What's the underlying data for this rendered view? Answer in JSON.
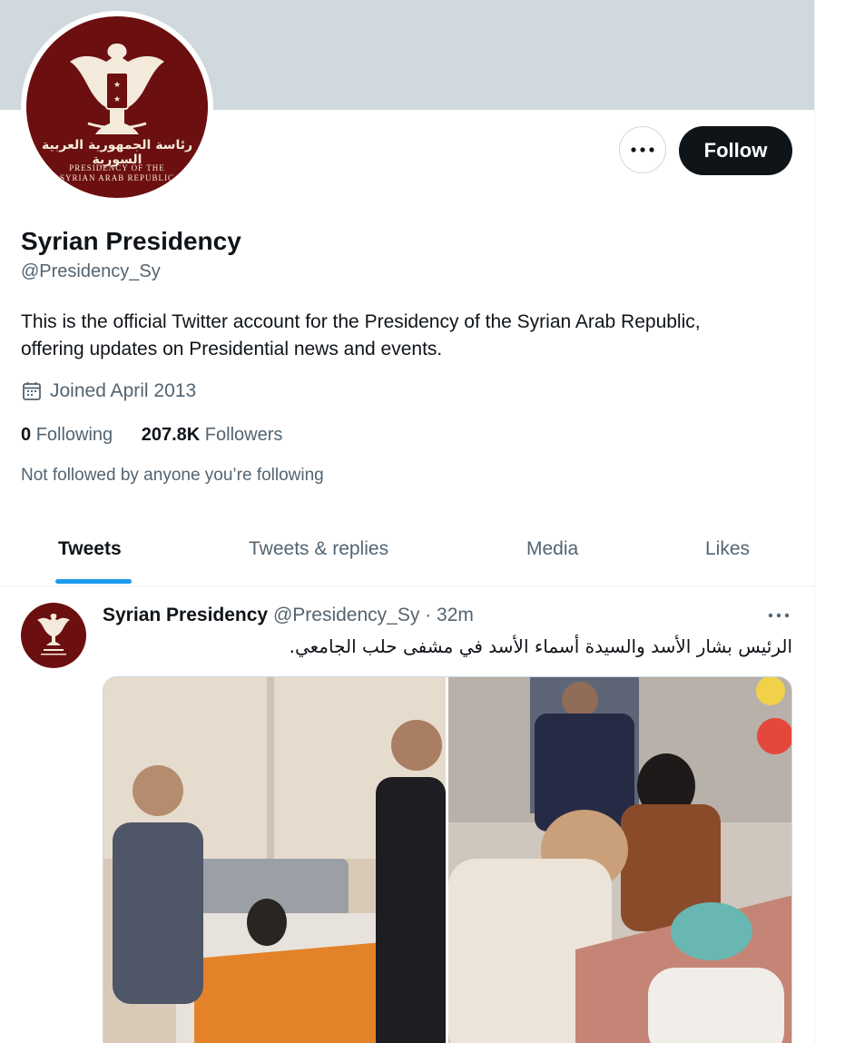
{
  "profile": {
    "avatar_arabic": "رئاسة الجمهورية العربية السورية",
    "avatar_english_line1": "PRESIDENCY OF THE",
    "avatar_english_line2": "SYRIAN ARAB REPUBLIC",
    "name": "Syrian Presidency",
    "handle": "@Presidency_Sy",
    "bio": "This is the official Twitter account for the Presidency of the Syrian Arab Republic, offering updates on Presidential news and events.",
    "joined": "Joined April 2013",
    "following_count": "0",
    "following_label": "Following",
    "followers_count": "207.8K",
    "followers_label": "Followers",
    "not_followed_text": "Not followed by anyone you’re following"
  },
  "actions": {
    "follow_label": "Follow",
    "more_icon": "more-horizontal-icon"
  },
  "tabs": [
    {
      "label": "Tweets",
      "active": true
    },
    {
      "label": "Tweets & replies",
      "active": false
    },
    {
      "label": "Media",
      "active": false
    },
    {
      "label": "Likes",
      "active": false
    }
  ],
  "tweet": {
    "name": "Syrian Presidency",
    "handle": "@Presidency_Sy",
    "separator": "·",
    "time": "32m",
    "text": "الرئيس بشار الأسد والسيدة أسماء الأسد في مشفى حلب الجامعي."
  },
  "colors": {
    "banner": "#cfd9de",
    "avatar_bg": "#6b0f10",
    "accent": "#1d9bf0",
    "text_primary": "#0f1419",
    "text_secondary": "#536471"
  }
}
